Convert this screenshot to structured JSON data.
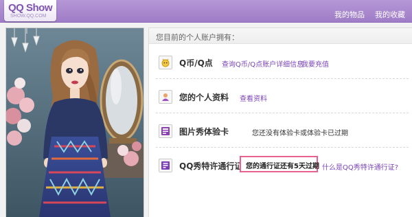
{
  "brand": {
    "logo_main": "QQ Show",
    "logo_sub": "SHOW.QQ.COM"
  },
  "header": {
    "nav": [
      {
        "label": "我的物品"
      },
      {
        "label": "我的收藏"
      }
    ]
  },
  "account": {
    "heading": "您目前的个人账户拥有：",
    "rows": [
      {
        "icon": "coin-icon",
        "title": "Q币/Q点",
        "links": [
          "查询Q币/Q点账户详细信息",
          "我要充值"
        ]
      },
      {
        "icon": "profile-icon",
        "title": "您的个人资料",
        "links": [
          "查看资料"
        ]
      },
      {
        "icon": "photo-card-icon",
        "title": "图片秀体验卡",
        "status": "您还没有体验卡或体验卡已过期"
      },
      {
        "icon": "pass-icon",
        "title": "QQ秀特许通行证",
        "status": "您的通行证还有5天过期",
        "links": [
          "什么是QQ秀特许通行证?"
        ]
      }
    ]
  },
  "colors": {
    "topbar": "#a98acf",
    "link": "#7b45b8",
    "highlight_border": "#e8608f"
  }
}
